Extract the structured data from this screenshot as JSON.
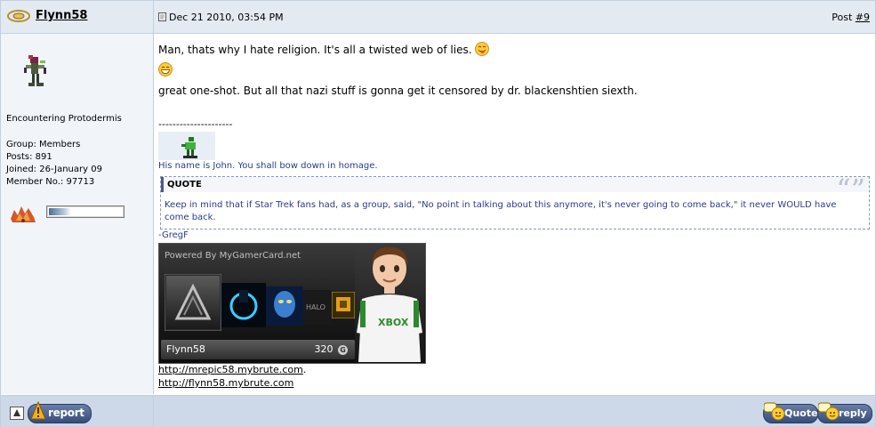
{
  "post": {
    "author": "Flynn58",
    "date": "Dec 21 2010, 03:54 PM",
    "post_label": "Post ",
    "post_number": "#9"
  },
  "user": {
    "title": "Encountering Protodermis",
    "details": [
      "Group: Members",
      "Posts: 891",
      "Joined: 26-January 09",
      "Member No.: 97713"
    ],
    "reputation_fraction": 0.3
  },
  "message": {
    "line1": "Man, thats why I hate religion. It's all a twisted web of lies.",
    "line3": "great one-shot. But all that nazi stuff is gonna get it censored by dr. blackenshtien siexth."
  },
  "signature": {
    "divider": "---------------------",
    "line": "His name is John. You shall bow down in homage.",
    "quote_header": "QUOTE",
    "quote_text": "Keep in mind that if Star Trek fans had, as a group, said, \"No point in talking about this anymore, it's never going to come back,\" it never WOULD have come back.",
    "quote_author": "-GregF",
    "gamercard": {
      "powered_by": "Powered By MyGamerCard.net",
      "gamertag": "Flynn58",
      "score": "320",
      "score_icon": "G",
      "shirt_text": "XBOX"
    },
    "links": [
      "http://mrepic58.mybrute.com",
      "http://flynn58.mybrute.com"
    ],
    "link1_suffix": "."
  },
  "footer": {
    "report_label": "report",
    "quote_label": "Quote",
    "reply_label": "reply"
  },
  "colors": {
    "header_bg": "#e4eaf2",
    "panel_bg": "#f1f4f9",
    "footer_bg": "#cdd8e8",
    "quote_text": "#2b3a8a"
  }
}
